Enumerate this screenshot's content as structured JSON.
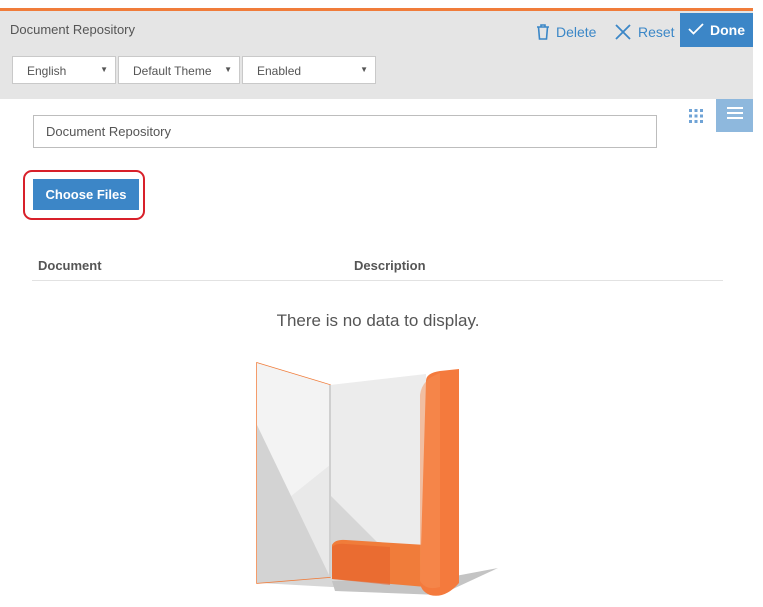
{
  "header": {
    "title": "Document Repository",
    "actions": {
      "delete_label": "Delete",
      "reset_label": "Reset",
      "done_label": "Done"
    }
  },
  "filters": {
    "language": {
      "selected": "English"
    },
    "theme": {
      "selected": "Default Theme"
    },
    "status": {
      "selected": "Enabled"
    }
  },
  "view_toggle": {
    "grid_icon": "grid-dots-icon",
    "list_icon": "hamburger-list-icon",
    "active": "list"
  },
  "main": {
    "title_input_value": "Document Repository",
    "choose_files_label": "Choose Files",
    "table": {
      "columns": [
        "Document",
        "Description"
      ],
      "rows": [],
      "empty_message": "There is no data to display."
    }
  },
  "colors": {
    "accent": "#f07c3a",
    "primary": "#3c86c7",
    "highlight": "#d8202a",
    "header_bg": "#e5e5e5"
  }
}
